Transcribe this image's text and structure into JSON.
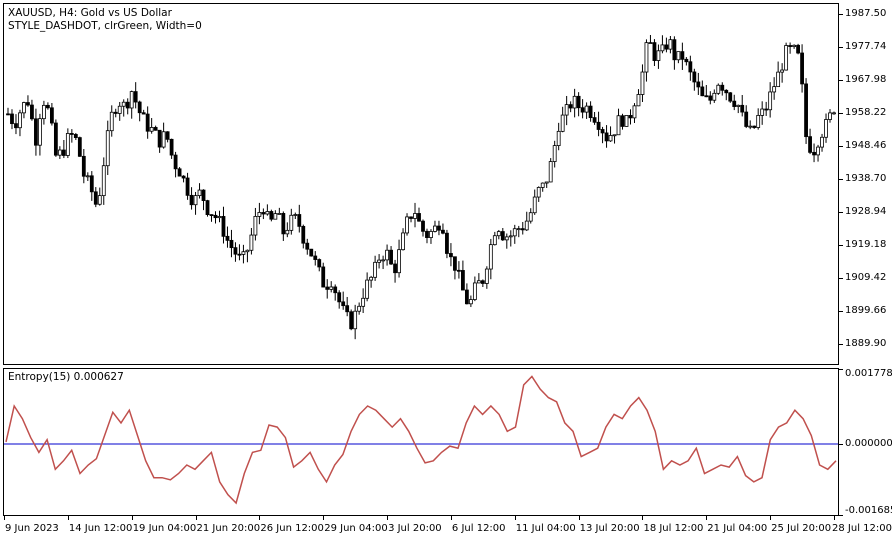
{
  "main_chart": {
    "symbol_line": "XAUUSD, H4:  Gold vs US Dollar",
    "style_line": "STYLE_DASHDOT, clrGreen, Width=0",
    "price_axis": [
      "1987.50",
      "1977.74",
      "1967.98",
      "1958.22",
      "1948.46",
      "1938.70",
      "1928.94",
      "1919.18",
      "1909.42",
      "1899.66",
      "1889.90"
    ]
  },
  "indicator": {
    "label": "Entropy(15) 0.000627",
    "axis": [
      "0.001778",
      "0.000000",
      "-0.001685"
    ],
    "line_color": "#c0504d",
    "zero_color": "#0000cd"
  },
  "time_axis": [
    "9 Jun 2023",
    "14 Jun 12:00",
    "19 Jun 04:00",
    "21 Jun 20:00",
    "26 Jun 12:00",
    "29 Jun 04:00",
    "3 Jul 20:00",
    "6 Jul 12:00",
    "11 Jul 04:00",
    "13 Jul 20:00",
    "18 Jul 12:00",
    "21 Jul 04:00",
    "25 Jul 20:00",
    "28 Jul 12:00"
  ],
  "chart_data": [
    {
      "type": "candlestick",
      "title": "XAUUSD, H4:  Gold vs US Dollar",
      "ylim": [
        1884.0,
        1990.5
      ],
      "ylabel": "",
      "path": [
        1958,
        1955,
        1960,
        1962,
        1950,
        1963,
        1958,
        1945,
        1947,
        1952,
        1950,
        1940,
        1936,
        1930,
        1945,
        1957,
        1962,
        1960,
        1965,
        1959,
        1955,
        1953,
        1950,
        1952,
        1944,
        1941,
        1936,
        1932,
        1935,
        1930,
        1928,
        1925,
        1920,
        1917,
        1914,
        1919,
        1927,
        1931,
        1925,
        1929,
        1923,
        1926,
        1927,
        1921,
        1917,
        1912,
        1907,
        1909,
        1903,
        1898,
        1896,
        1902,
        1907,
        1910,
        1916,
        1917,
        1911,
        1918,
        1926,
        1930,
        1924,
        1922,
        1924,
        1927,
        1916,
        1913,
        1906,
        1901,
        1907,
        1909,
        1918,
        1926,
        1922,
        1922,
        1924,
        1925,
        1929,
        1935,
        1937,
        1944,
        1955,
        1958,
        1962,
        1960,
        1960,
        1958,
        1955,
        1951,
        1953,
        1957,
        1955,
        1962,
        1968,
        1980,
        1975,
        1976,
        1980,
        1974,
        1975,
        1970,
        1966,
        1962,
        1962,
        1968,
        1966,
        1963,
        1961,
        1955,
        1952,
        1957,
        1959,
        1965,
        1970,
        1976,
        1977,
        1974,
        1950,
        1947,
        1952,
        1955,
        1960
      ]
    },
    {
      "type": "line",
      "title": "Entropy(15) 0.000627",
      "ylim": [
        -0.001685,
        0.001778
      ],
      "ylabel": "",
      "series": [
        {
          "name": "Entropy(15)",
          "values": [
            5e-05,
            0.0009,
            0.0006,
            0.00015,
            -0.0002,
            0.0001,
            -0.0006,
            -0.0004,
            -0.00015,
            -0.0007,
            -0.0005,
            -0.00035,
            0.0002,
            0.00075,
            0.0005,
            0.0008,
            0.0002,
            -0.0004,
            -0.0008,
            -0.0008,
            -0.00085,
            -0.0007,
            -0.0005,
            -0.0006,
            -0.0004,
            -0.0002,
            -0.0009,
            -0.0012,
            -0.0014,
            -0.0007,
            -0.0002,
            -0.00015,
            0.00045,
            0.0004,
            0.00015,
            -0.00055,
            -0.0004,
            -0.0002,
            -0.0006,
            -0.0009,
            -0.0005,
            -0.00025,
            0.0003,
            0.0007,
            0.0009,
            0.0008,
            0.0006,
            0.0004,
            0.0006,
            0.0003,
            -0.0001,
            -0.00045,
            -0.0004,
            -0.0002,
            -5e-05,
            -0.0001,
            0.0005,
            0.0009,
            0.0007,
            0.0009,
            0.0007,
            0.0003,
            0.0004,
            0.0014,
            0.0016,
            0.0013,
            0.0011,
            0.001,
            0.0005,
            0.0003,
            -0.0003,
            -0.0002,
            -0.0001,
            0.0004,
            0.0007,
            0.0006,
            0.0009,
            0.0011,
            0.0008,
            0.0003,
            -0.0006,
            -0.0004,
            -0.0005,
            -0.0004,
            -0.0001,
            -0.0007,
            -0.0006,
            -0.0005,
            -0.00055,
            -0.0003,
            -0.00075,
            -0.0009,
            -0.0008,
            0.0001,
            0.0004,
            0.0005,
            0.0008,
            0.0006,
            0.0002,
            -0.0005,
            -0.0006,
            -0.0004
          ]
        }
      ]
    }
  ]
}
